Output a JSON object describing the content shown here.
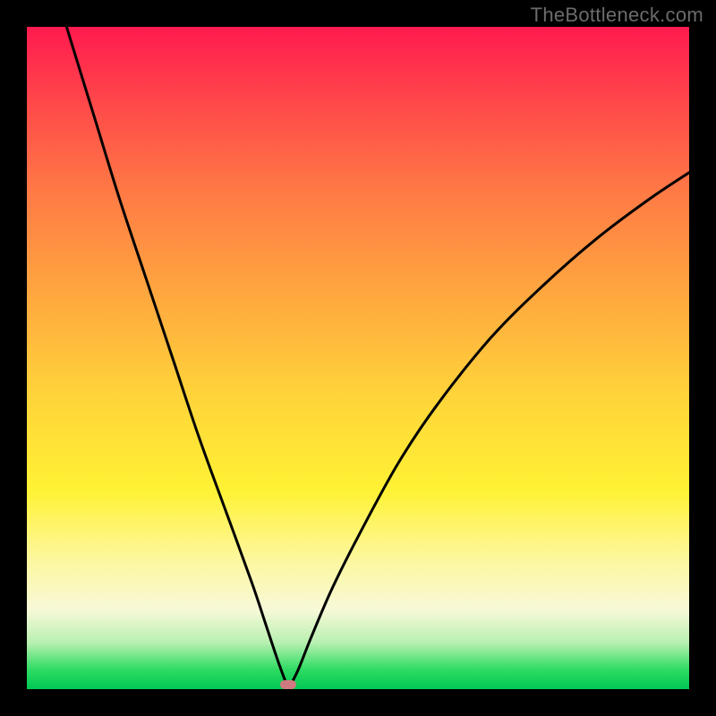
{
  "watermark": "TheBottleneck.com",
  "marker": {
    "x_pct": 39.5,
    "y_pct": 99.3
  },
  "colors": {
    "curve_stroke": "#000000",
    "marker_fill": "#cf7a80",
    "frame_border": "#000000"
  },
  "chart_data": {
    "type": "line",
    "title": "",
    "xlabel": "",
    "ylabel": "",
    "xlim": [
      0,
      100
    ],
    "ylim": [
      0,
      100
    ],
    "grid": false,
    "legend": false,
    "series": [
      {
        "name": "bottleneck-curve",
        "x": [
          6,
          10,
          14,
          18,
          22,
          26,
          30,
          34,
          36,
          38,
          39.5,
          41,
          43,
          46,
          50,
          56,
          62,
          70,
          78,
          86,
          94,
          100
        ],
        "y": [
          100,
          87,
          74,
          62,
          50,
          38,
          27,
          16,
          10,
          4,
          0,
          3,
          8,
          15,
          23,
          34,
          43,
          53,
          61,
          68,
          74,
          78
        ]
      }
    ],
    "marker_point": {
      "x": 39.5,
      "y": 0
    },
    "background_gradient": {
      "orientation": "vertical",
      "stops": [
        {
          "pos": 0,
          "color": "#ff1a4f"
        },
        {
          "pos": 12,
          "color": "#ff4a4a"
        },
        {
          "pos": 25,
          "color": "#ff7a45"
        },
        {
          "pos": 40,
          "color": "#ffa63f"
        },
        {
          "pos": 55,
          "color": "#ffd23a"
        },
        {
          "pos": 70,
          "color": "#fff234"
        },
        {
          "pos": 80,
          "color": "#fdf79a"
        },
        {
          "pos": 88,
          "color": "#f7f9d8"
        },
        {
          "pos": 93,
          "color": "#b8f0b0"
        },
        {
          "pos": 97,
          "color": "#2fdc63"
        },
        {
          "pos": 100,
          "color": "#00c853"
        }
      ]
    }
  }
}
